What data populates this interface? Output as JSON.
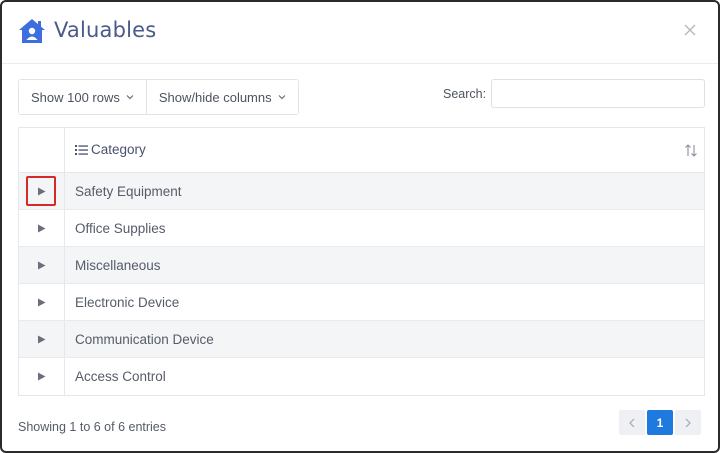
{
  "modal": {
    "title": "Valuables",
    "accent_color": "#3d6ee0"
  },
  "toolbar": {
    "rows_label": "Show 100 rows",
    "columns_label": "Show/hide columns",
    "search_label": "Search:",
    "search_value": ""
  },
  "table": {
    "column_header": "Category",
    "rows": [
      {
        "label": "Safety Equipment"
      },
      {
        "label": "Office Supplies"
      },
      {
        "label": "Miscellaneous"
      },
      {
        "label": "Electronic Device"
      },
      {
        "label": "Communication Device"
      },
      {
        "label": "Access Control"
      }
    ]
  },
  "footer": {
    "info": "Showing 1 to 6 of 6 entries",
    "current_page": "1"
  }
}
